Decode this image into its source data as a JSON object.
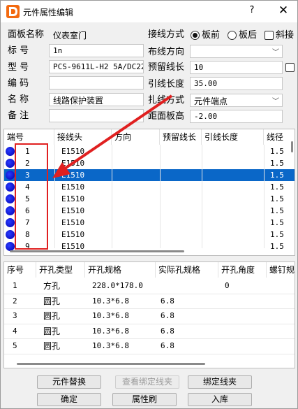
{
  "window": {
    "title": "元件属性编辑",
    "help": "?",
    "close": "✕"
  },
  "form": {
    "panel_name_label": "面板名称",
    "panel_name_value": "仪表室门",
    "tag_label": "标 号",
    "tag_value": "1n",
    "model_label": "型 号",
    "model_value": "PCS-9611L-H2 5A/DC220V",
    "code_label": "编 码",
    "code_value": "",
    "name_label": "名 称",
    "name_value": "线路保护装置",
    "note_label": "备 注",
    "note_value": "",
    "wiring_mode_label": "接线方式",
    "wiring_front": "板前",
    "wiring_back": "板后",
    "wiring_inclined": "斜接",
    "routing_dir_label": "布线方向",
    "routing_dir_value": "",
    "reserve_len_label": "预留线长",
    "reserve_len_value": "10",
    "lead_len_label": "引线长度",
    "lead_len_value": "35.00",
    "tie_mode_label": "扎线方式",
    "tie_mode_value": "元件端点",
    "board_height_label": "距面板高",
    "board_height_value": "-2.00"
  },
  "terminals": {
    "headers": [
      "端号",
      "接线头",
      "方向",
      "预留线长",
      "引线长度",
      "线径"
    ],
    "rows": [
      {
        "no": "1",
        "head": "E1510",
        "gauge": "1.5"
      },
      {
        "no": "2",
        "head": "E1510",
        "gauge": "1.5"
      },
      {
        "no": "3",
        "head": "E1510",
        "gauge": "1.5"
      },
      {
        "no": "4",
        "head": "E1510",
        "gauge": "1.5"
      },
      {
        "no": "5",
        "head": "E1510",
        "gauge": "1.5"
      },
      {
        "no": "6",
        "head": "E1510",
        "gauge": "1.5"
      },
      {
        "no": "7",
        "head": "E1510",
        "gauge": "1.5"
      },
      {
        "no": "8",
        "head": "E1510",
        "gauge": "1.5"
      },
      {
        "no": "9",
        "head": "E1510",
        "gauge": "1.5"
      }
    ],
    "selected_index": 2
  },
  "holes": {
    "headers": [
      "序号",
      "开孔类型",
      "开孔规格",
      "实际孔规格",
      "开孔角度",
      "螺钉规"
    ],
    "rows": [
      {
        "no": "1",
        "type": "方孔",
        "spec": "228.0*178.0",
        "actual": "",
        "angle": "0"
      },
      {
        "no": "2",
        "type": "圆孔",
        "spec": "10.3*6.8",
        "actual": "6.8",
        "angle": ""
      },
      {
        "no": "3",
        "type": "圆孔",
        "spec": "10.3*6.8",
        "actual": "6.8",
        "angle": ""
      },
      {
        "no": "4",
        "type": "圆孔",
        "spec": "10.3*6.8",
        "actual": "6.8",
        "angle": ""
      },
      {
        "no": "5",
        "type": "圆孔",
        "spec": "10.3*6.8",
        "actual": "6.8",
        "angle": ""
      }
    ]
  },
  "buttons": {
    "replace": "元件替换",
    "view_bound": "查看绑定线夹",
    "bind": "绑定线夹",
    "ok": "确定",
    "brush": "属性刷",
    "store": "入库"
  },
  "colors": {
    "selection": "#0a67c8",
    "annotation": "#e02020",
    "terminal_dot": "#1a1aff"
  }
}
